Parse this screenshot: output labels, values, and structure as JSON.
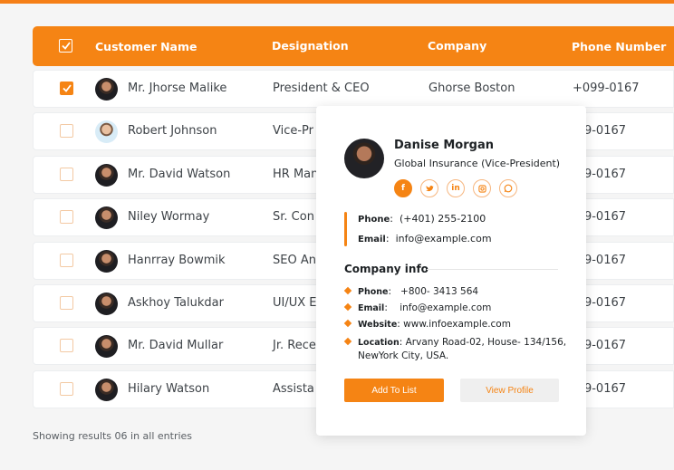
{
  "table": {
    "columns": [
      "Customer Name",
      "Designation",
      "Company",
      "Phone Number"
    ],
    "rows": [
      {
        "name": "Mr. Jhorse Malike",
        "designation": "President & CEO",
        "company": "Ghorse Boston",
        "phone": "+099-0167",
        "checked": true
      },
      {
        "name": "Robert Johnson",
        "designation": "Vice-Pr",
        "company": "",
        "phone": "-99-0167",
        "checked": false
      },
      {
        "name": "Mr. David Watson",
        "designation": "HR Man",
        "company": "",
        "phone": "-99-0167",
        "checked": false
      },
      {
        "name": "Niley Wormay",
        "designation": "Sr. Con",
        "company": "",
        "phone": "-99-0167",
        "checked": false
      },
      {
        "name": "Hanrray Bowmik",
        "designation": "SEO An",
        "company": "",
        "phone": "-99-0167",
        "checked": false
      },
      {
        "name": "Askhoy Talukdar",
        "designation": "UI/UX E",
        "company": "",
        "phone": "-99-0167",
        "checked": false
      },
      {
        "name": "Mr. David Mullar",
        "designation": "Jr. Rece",
        "company": "",
        "phone": "-99-0167",
        "checked": false
      },
      {
        "name": "Hilary Watson",
        "designation": "Assista",
        "company": "",
        "phone": "-99-0167",
        "checked": false
      }
    ]
  },
  "footer": {
    "text": "Showing results 06 in all entries"
  },
  "popup": {
    "name": "Danise Morgan",
    "company": "Global Insurance",
    "role": "(Vice-President)",
    "socials": [
      "f",
      "t",
      "in",
      "ig",
      "wa"
    ],
    "phone_label": "Phone",
    "phone": "(+401) 255-2100",
    "email_label": "Email",
    "email": "info@example.com",
    "company_info": {
      "heading": "Company info",
      "phone_label": "Phone",
      "phone": "+800- 3413 564",
      "email_label": "Email",
      "email": "info@example.com",
      "website_label": "Website",
      "website": "www.infoexample.com",
      "location_label": "Location",
      "location_line1": "Arvany Road-02, House- 134/156,",
      "location_line2": "NewYork City, USA."
    },
    "add_button": "Add To List",
    "view_button": "View Profile"
  },
  "colors": {
    "accent": "#f58414",
    "background": "#f5f5f5"
  }
}
